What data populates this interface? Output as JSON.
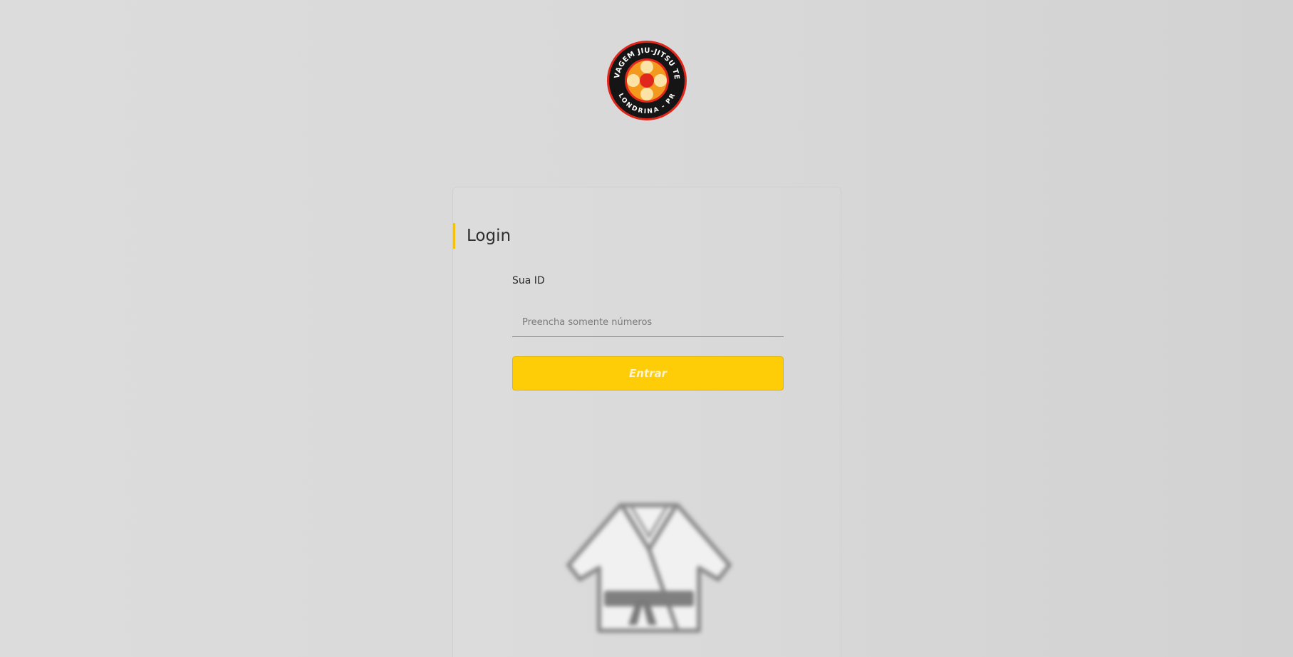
{
  "logo": {
    "top_text": "SELVAGEM JIU-JITSU TEAM",
    "bottom_text": "LONDRINA - PR",
    "colors": {
      "ring": "#1a1a1a",
      "border": "#e1261c",
      "center": "#f39a1e",
      "accent": "#e1261c"
    }
  },
  "login": {
    "title": "Login",
    "id_label": "Sua ID",
    "id_placeholder": "Preencha somente números",
    "id_value": "",
    "submit_label": "Entrar"
  },
  "illustration": {
    "icon": "jiu-jitsu-gi-icon"
  },
  "colors": {
    "accent": "#ffcc08",
    "title_bar": "#f4c20d",
    "background": "#d9d9d9"
  }
}
